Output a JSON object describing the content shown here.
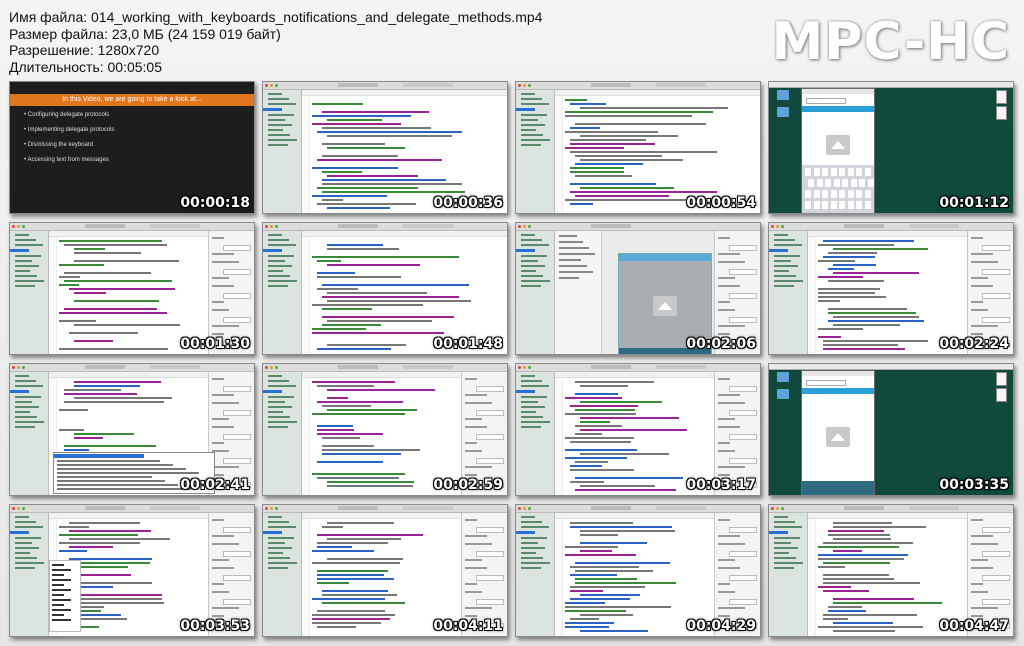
{
  "info": {
    "file_name": "Имя файла: 014_working_with_keyboards_notifications_and_delegate_methods.mp4",
    "file_size": "Размер файла: 23,0 МБ (24 159 019 байт)",
    "resolution": "Разрешение: 1280x720",
    "duration": "Длительность: 00:05:05"
  },
  "logo": "MPC-HC",
  "slide": {
    "header": "In this Video, we are going to take a look at...",
    "bullets": [
      "Configuring delegate protocols",
      "Implementing delegate protocols",
      "Dismissing the keyboard",
      "Accessing text from messages"
    ]
  },
  "thumbnails": [
    {
      "time": "00:00:18",
      "kind": "slide"
    },
    {
      "time": "00:00:36",
      "kind": "xcode"
    },
    {
      "time": "00:00:54",
      "kind": "xcode"
    },
    {
      "time": "00:01:12",
      "kind": "simulator-keyboard"
    },
    {
      "time": "00:01:30",
      "kind": "xcode-inspector"
    },
    {
      "time": "00:01:48",
      "kind": "xcode"
    },
    {
      "time": "00:02:06",
      "kind": "storyboard"
    },
    {
      "time": "00:02:24",
      "kind": "xcode-inspector"
    },
    {
      "time": "00:02:41",
      "kind": "xcode-autocomplete"
    },
    {
      "time": "00:02:59",
      "kind": "xcode-inspector"
    },
    {
      "time": "00:03:17",
      "kind": "xcode-inspector"
    },
    {
      "time": "00:03:35",
      "kind": "simulator"
    },
    {
      "time": "00:03:53",
      "kind": "xcode-palette"
    },
    {
      "time": "00:04:11",
      "kind": "xcode-inspector"
    },
    {
      "time": "00:04:29",
      "kind": "xcode-inspector"
    },
    {
      "time": "00:04:47",
      "kind": "xcode-inspector"
    }
  ]
}
